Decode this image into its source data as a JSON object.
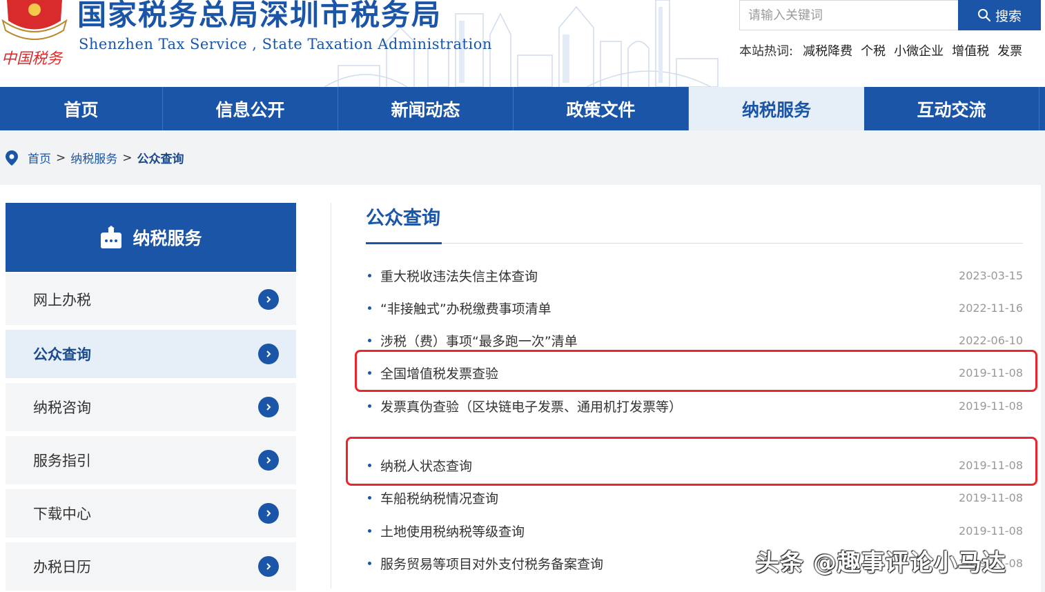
{
  "header": {
    "title": "国家税务总局深圳市税务局",
    "subtitle": "Shenzhen Tax Service , State Taxation Administration",
    "emblem_text": "中国税务"
  },
  "search": {
    "placeholder": "请输入关键词",
    "button_label": "搜索"
  },
  "hotwords": {
    "label": "本站热词:",
    "items": [
      "减税降费",
      "个税",
      "小微企业",
      "增值税",
      "发票"
    ]
  },
  "nav": {
    "items": [
      "首页",
      "信息公开",
      "新闻动态",
      "政策文件",
      "纳税服务",
      "互动交流"
    ],
    "active": "纳税服务"
  },
  "breadcrumb": {
    "items": [
      "首页",
      "纳税服务",
      "公众查询"
    ],
    "separator": ">"
  },
  "sidebar": {
    "title": "纳税服务",
    "items": [
      "网上办税",
      "公众查询",
      "纳税咨询",
      "服务指引",
      "下载中心",
      "办税日历"
    ],
    "active": "公众查询"
  },
  "main": {
    "title": "公众查询",
    "list": [
      {
        "title": "重大税收违法失信主体查询",
        "date": "2023-03-15"
      },
      {
        "title": "“非接触式”办税缴费事项清单",
        "date": "2022-11-16"
      },
      {
        "title": "涉税（费）事项“最多跑一次”清单",
        "date": "2022-06-10"
      },
      {
        "title": "全国增值税发票查验",
        "date": "2019-11-08"
      },
      {
        "title": "发票真伪查验（区块链电子发票、通用机打发票等）",
        "date": "2019-11-08"
      },
      {
        "title": "纳税人状态查询",
        "date": "2019-11-08"
      },
      {
        "title": "车船税纳税情况查询",
        "date": "2019-11-08"
      },
      {
        "title": "土地使用税纳税等级查询",
        "date": "2019-11-08"
      },
      {
        "title": "服务贸易等项目对外支付税务备案查询",
        "date": "2019-11-08"
      }
    ]
  },
  "watermark": "头条 @趣事评论小马达",
  "colors": {
    "brand_blue": "#1a55a8",
    "active_bg": "#e6eef8",
    "highlight_red": "#e8262c"
  }
}
